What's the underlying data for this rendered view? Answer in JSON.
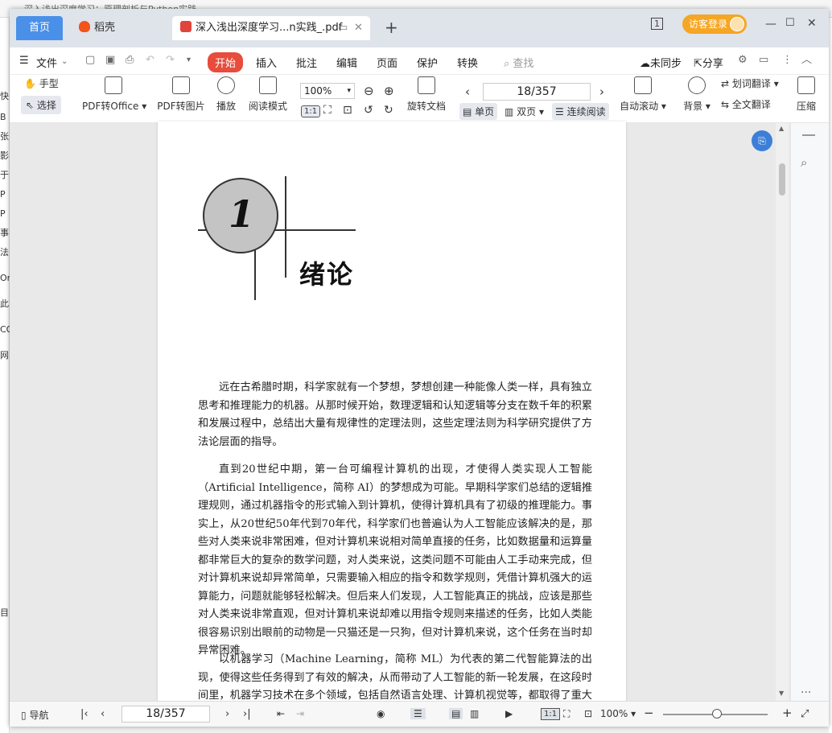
{
  "background_window": {
    "title": "深入浅出深度学习：原理剖析与Python实践",
    "side_fragments": [
      "快",
      "B",
      "张",
      "影",
      "于",
      "P",
      "P",
      "事",
      "法",
      "Or",
      "此",
      "CO",
      "网",
      "目"
    ]
  },
  "tabs": {
    "home": "首页",
    "daoke": "稻壳",
    "pdf": "深入浅出深度学习...n实践_.pdf",
    "add": "+"
  },
  "window": {
    "login": "访客登录",
    "page_counter_icon": "1"
  },
  "menu": {
    "file": "文件",
    "start": "开始",
    "insert": "插入",
    "annotate": "批注",
    "edit": "编辑",
    "page": "页面",
    "protect": "保护",
    "convert": "转换",
    "search": "查找",
    "sync": "未同步",
    "share": "分享"
  },
  "toolbar": {
    "hand": "手型",
    "select": "选择",
    "pdf_to_office": "PDF转Office",
    "pdf_to_image": "PDF转图片",
    "play": "播放",
    "read_mode": "阅读模式",
    "zoom": "100%",
    "page": "18/357",
    "rotate": "旋转文档",
    "single": "单页",
    "double": "双页",
    "continuous": "连续阅读",
    "auto_scroll": "自动滚动",
    "background": "背景",
    "word_translate": "划词翻译",
    "full_translate": "全文翻译",
    "compress": "压缩",
    "one_to_one": "1:1"
  },
  "document": {
    "chapter_number": "1",
    "chapter_title": "绪论",
    "paragraphs": [
      "远在古希腊时期，科学家就有一个梦想，梦想创建一种能像人类一样，具有独立思考和推理能力的机器。从那时候开始，数理逻辑和认知逻辑等分支在数千年的积累和发展过程中，总结出大量有规律性的定理法则，这些定理法则为科学研究提供了方法论层面的指导。",
      "直到20世纪中期，第一台可编程计算机的出现，才使得人类实现人工智能（Artificial Intelligence，简称 AI）的梦想成为可能。早期科学家们总结的逻辑推理规则，通过机器指令的形式输入到计算机，使得计算机具有了初级的推理能力。事实上，从20世纪50年代到70年代，科学家们也普遍认为人工智能应该解决的是，那些对人类来说非常困难，但对计算机来说相对简单直接的任务，比如数据量和运算量都非常巨大的复杂的数学问题，对人类来说，这类问题不可能由人工手动来完成，但对计算机来说却异常简单，只需要输入相应的指令和数学规则，凭借计算机强大的运算能力，问题就能够轻松解决。但后来人们发现，人工智能真正的挑战，应该是那些对人类来说非常直观，但对计算机来说却难以用指令规则来描述的任务，比如人类能很容易识别出眼前的动物是一只猫还是一只狗，但对计算机来说，这个任务在当时却异常困难。",
      "以机器学习（Machine Learning，简称 ML）为代表的第二代智能算法的出现，使得这些任务得到了有效的解决，从而带动了人工智能的新一轮发展，在这段时间里，机器学习技术在多个领域，包括自然语言处理、计算机视觉等，都取得了重大的突破。"
    ]
  },
  "status": {
    "nav": "导航",
    "page": "18/357",
    "zoom": "100%",
    "one_to_one": "1:1"
  }
}
